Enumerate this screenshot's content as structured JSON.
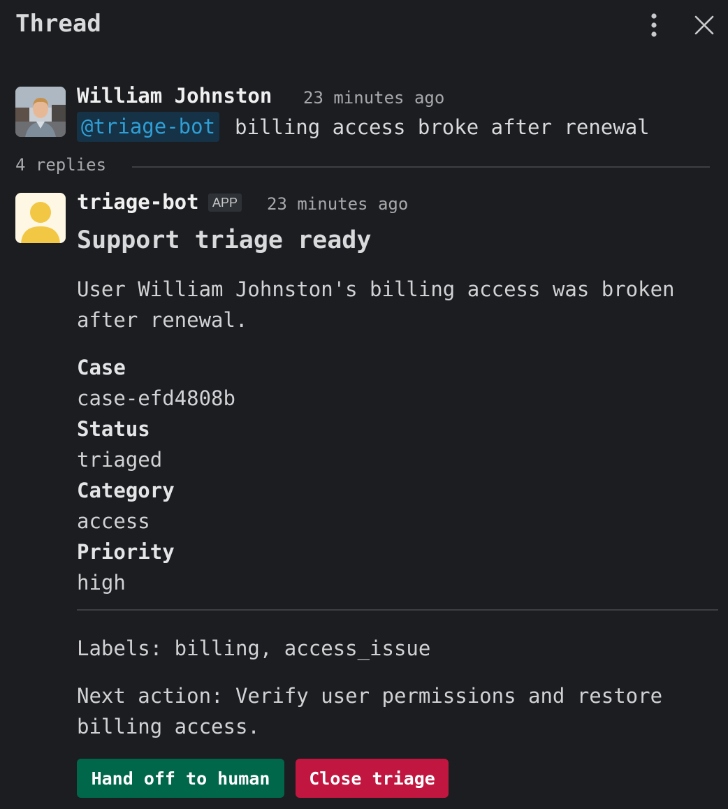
{
  "header": {
    "title": "Thread"
  },
  "root_message": {
    "author": "William Johnston",
    "time": "23 minutes ago",
    "mention": "@triage-bot",
    "text": "billing access broke after renewal"
  },
  "replies": {
    "count_label": "4 replies"
  },
  "bot_message": {
    "author": "triage-bot",
    "badge": "APP",
    "time": "23 minutes ago",
    "title": "Support triage ready",
    "summary": "User William Johnston's billing access was broken after renewal.",
    "fields": [
      {
        "label": "Case",
        "value": "case-efd4808b"
      },
      {
        "label": "Status",
        "value": "triaged"
      },
      {
        "label": "Category",
        "value": "access"
      },
      {
        "label": "Priority",
        "value": "high"
      }
    ],
    "labels_text": "Labels: billing, access_issue",
    "next_action_text": "Next action: Verify user permissions and restore billing access.",
    "buttons": {
      "handoff": "Hand off to human",
      "close": "Close triage"
    }
  },
  "colors": {
    "background": "#1b1d21",
    "mention_bg": "#163246",
    "mention_fg": "#2f9fd6",
    "handoff_button": "#00674a",
    "close_button": "#c0163f",
    "bot_avatar_bg": "#fdf7e4",
    "bot_avatar_fg": "#f2c744"
  },
  "icons": {
    "more": "vertical-ellipsis-icon",
    "close": "close-x-icon",
    "bot_avatar": "user-silhouette-icon"
  }
}
